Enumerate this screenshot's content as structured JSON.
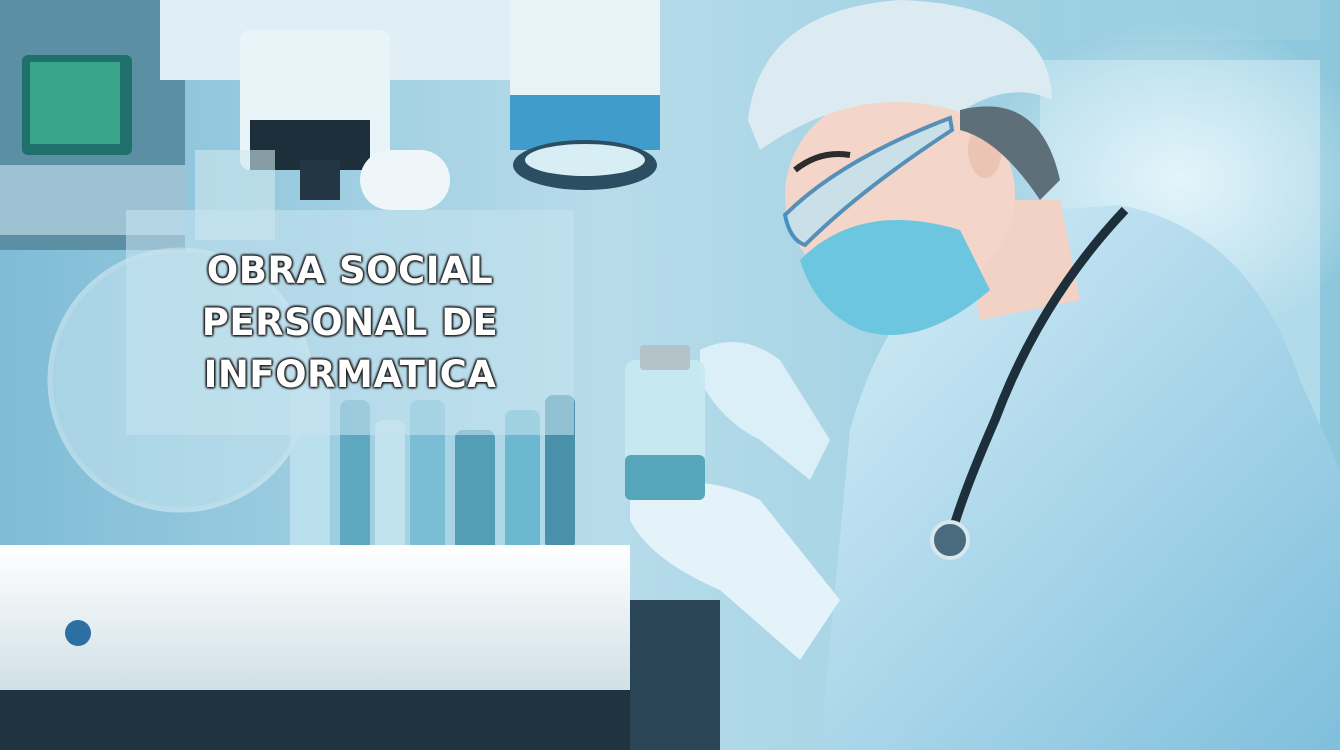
{
  "banner": {
    "title_lines": [
      "OBRA SOCIAL",
      "PERSONAL DE",
      "INFORMATICA"
    ]
  },
  "colors": {
    "background": "#a9d4e4",
    "lab_bench": "#f3f6f7",
    "scrubs": "#b6def0",
    "mask": "#6cc6df",
    "overlay": "#c6e4f0",
    "title_text": "#ffffff"
  }
}
